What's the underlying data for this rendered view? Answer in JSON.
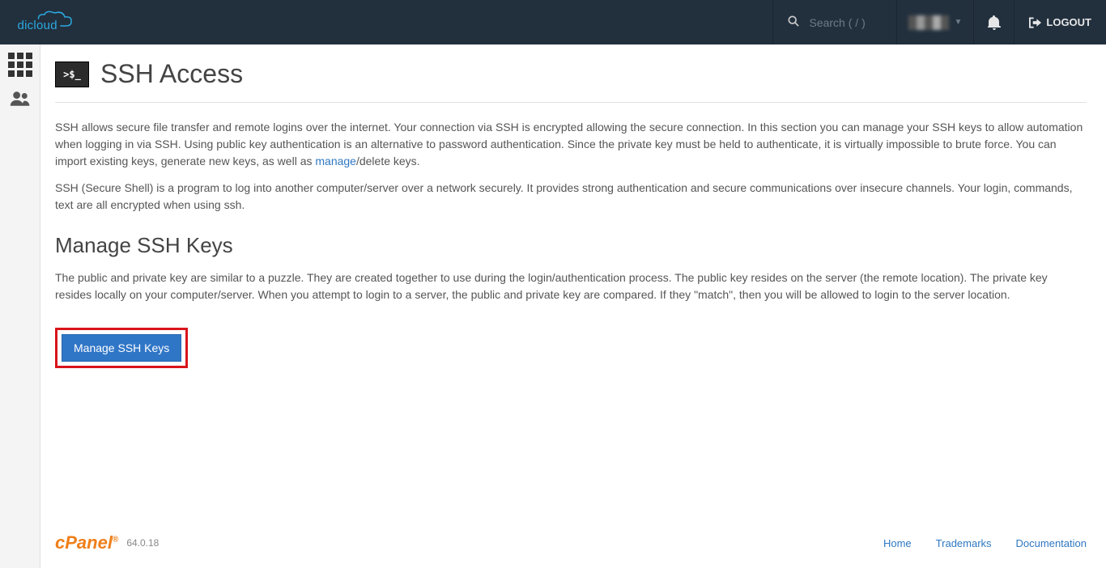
{
  "header": {
    "logo_text": "dicloud",
    "search_placeholder": "Search ( / )",
    "logout_label": "LOGOUT"
  },
  "page": {
    "title": "SSH Access",
    "icon_label": ">$_",
    "intro1_a": "SSH allows secure file transfer and remote logins over the internet. Your connection via SSH is encrypted allowing the secure connection. In this section you can manage your SSH keys to allow automation when logging in via SSH. Using public key authentication is an alternative to password authentication. Since the private key must be held to authenticate, it is virtually impossible to brute force. You can import existing keys, generate new keys, as well as ",
    "intro1_link": "manage",
    "intro1_b": "/delete keys.",
    "intro2": "SSH (Secure Shell) is a program to log into another computer/server over a network securely. It provides strong authentication and secure communications over insecure channels. Your login, commands, text are all encrypted when using ssh.",
    "section_title": "Manage SSH Keys",
    "section_text": "The public and private key are similar to a puzzle. They are created together to use during the login/authentication process. The public key resides on the server (the remote location). The private key resides locally on your computer/server. When you attempt to login to a server, the public and private key are compared. If they \"match\", then you will be allowed to login to the server location.",
    "button_label": "Manage SSH Keys"
  },
  "footer": {
    "brand": "cPanel",
    "version": "64.0.18",
    "links": [
      "Home",
      "Trademarks",
      "Documentation"
    ]
  }
}
